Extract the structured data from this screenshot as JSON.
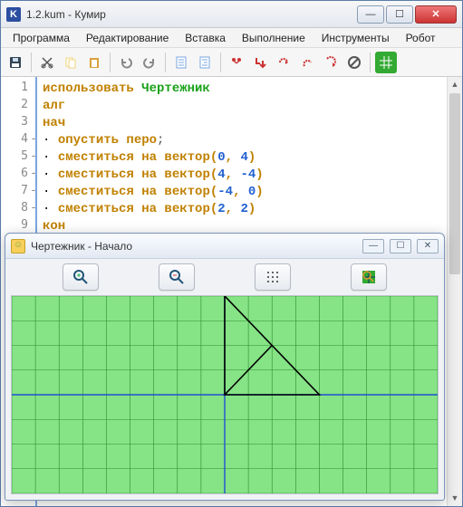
{
  "window": {
    "title": "1.2.kum - Кумир",
    "app_icon_letter": "K"
  },
  "menu": {
    "items": [
      "Программа",
      "Редактирование",
      "Вставка",
      "Выполнение",
      "Инструменты",
      "Робот"
    ]
  },
  "toolbar_icons": {
    "save": "save-icon",
    "cut": "cut-icon",
    "copy": "copy-icon",
    "paste": "paste-icon",
    "undo": "undo-icon",
    "redo": "redo-icon",
    "doc1": "doc-icon",
    "doc2": "doc-icon",
    "run": "run-icon",
    "step_into": "step-into-icon",
    "step_over": "step-over-icon",
    "step_out": "step-out-icon",
    "pause": "pause-icon",
    "stop": "stop-icon",
    "grid": "grid-icon"
  },
  "editor": {
    "lines": [
      {
        "n": 1,
        "indent": 0,
        "tokens": [
          [
            "kw",
            "использовать "
          ],
          [
            "actor",
            "Чертежник"
          ]
        ]
      },
      {
        "n": 2,
        "indent": 0,
        "tokens": [
          [
            "kw",
            "алг"
          ]
        ]
      },
      {
        "n": 3,
        "indent": 0,
        "tokens": [
          [
            "kw",
            "нач"
          ]
        ]
      },
      {
        "n": 4,
        "indent": 1,
        "sub": true,
        "tokens": [
          [
            "cmd",
            "опустить перо"
          ],
          [
            "semi",
            ";"
          ]
        ]
      },
      {
        "n": 5,
        "indent": 1,
        "sub": true,
        "tokens": [
          [
            "cmd",
            "сместиться на вектор"
          ],
          [
            "punct",
            "("
          ],
          [
            "num",
            "0"
          ],
          [
            "punct",
            ", "
          ],
          [
            "num",
            "4"
          ],
          [
            "punct",
            ")"
          ]
        ]
      },
      {
        "n": 6,
        "indent": 1,
        "sub": true,
        "tokens": [
          [
            "cmd",
            "сместиться на вектор"
          ],
          [
            "punct",
            "("
          ],
          [
            "num",
            "4"
          ],
          [
            "punct",
            ", "
          ],
          [
            "num",
            "-4"
          ],
          [
            "punct",
            ")"
          ]
        ]
      },
      {
        "n": 7,
        "indent": 1,
        "sub": true,
        "tokens": [
          [
            "cmd",
            "сместиться на вектор"
          ],
          [
            "punct",
            "("
          ],
          [
            "num",
            "-4"
          ],
          [
            "punct",
            ", "
          ],
          [
            "num",
            "0"
          ],
          [
            "punct",
            ")"
          ]
        ]
      },
      {
        "n": 8,
        "indent": 1,
        "sub": true,
        "tokens": [
          [
            "cmd",
            "сместиться на вектор"
          ],
          [
            "punct",
            "("
          ],
          [
            "num",
            "2"
          ],
          [
            "punct",
            ", "
          ],
          [
            "num",
            "2"
          ],
          [
            "punct",
            ")"
          ]
        ]
      },
      {
        "n": 9,
        "indent": 0,
        "tokens": [
          [
            "kw",
            "кон"
          ]
        ]
      }
    ]
  },
  "child": {
    "title": "Чертежник - Начало"
  },
  "chart_data": {
    "type": "line",
    "title": "",
    "origin": [
      0,
      0
    ],
    "visible_x_range": [
      -9,
      9
    ],
    "visible_y_range": [
      -4,
      4
    ],
    "grid_spacing": 1,
    "axes_color": "#2050d0",
    "grid_bg": "#86e386",
    "path": [
      [
        0,
        0
      ],
      [
        0,
        4
      ],
      [
        4,
        0
      ],
      [
        0,
        0
      ],
      [
        2,
        2
      ]
    ],
    "pen_down": true
  }
}
